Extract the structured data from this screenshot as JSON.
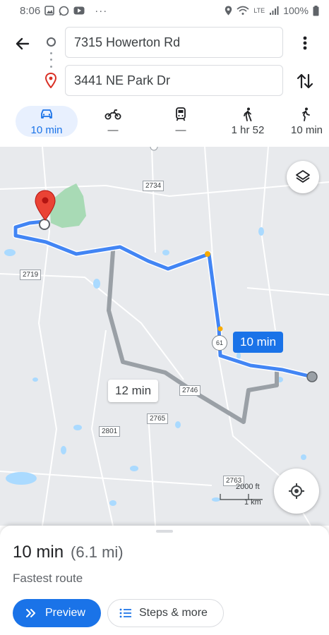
{
  "status_bar": {
    "time": "8:06",
    "battery": "100%",
    "network": "LTE"
  },
  "directions": {
    "origin": "7315 Howerton Rd",
    "destination": "3441 NE Park Dr"
  },
  "modes": [
    {
      "name": "drive",
      "icon": "car-icon",
      "label": "10 min",
      "selected": true
    },
    {
      "name": "motorcycle",
      "icon": "motorcycle-icon",
      "label": "—",
      "selected": false
    },
    {
      "name": "transit",
      "icon": "train-icon",
      "label": "—",
      "selected": false
    },
    {
      "name": "walk",
      "icon": "walk-icon",
      "label": "1 hr 52",
      "selected": false
    },
    {
      "name": "bike",
      "icon": "bike-icon",
      "label": "10 min",
      "selected": false
    }
  ],
  "map": {
    "route_main_label": "10 min",
    "route_alt_label": "12 min",
    "road_labels": [
      "2734",
      "2719",
      "2746",
      "2765",
      "2801",
      "2763"
    ],
    "highway_label": "61",
    "scale_ft": "2000 ft",
    "scale_km": "1 km",
    "colors": {
      "route_main": "#4285f4",
      "route_alt": "#9aa0a6",
      "water": "#aadaff",
      "park": "#a8dab5",
      "pin": "#ea4335"
    }
  },
  "summary": {
    "time": "10 min",
    "distance": "(6.1 mi)",
    "subtitle": "Fastest route"
  },
  "actions": {
    "preview": "Preview",
    "steps": "Steps & more"
  }
}
